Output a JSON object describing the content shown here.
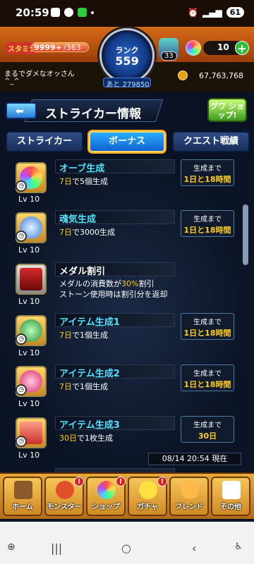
{
  "status": {
    "time": "20:59",
    "battery": "61"
  },
  "header": {
    "stamina_label": "スタミナ",
    "stamina_current": "9999+",
    "stamina_max": "/363",
    "rank_label": "ランク",
    "rank_value": "559",
    "exp_text": "あと 279850",
    "player_name": "まるでダメなオッさん",
    "player_sub": "^_^",
    "gem_count": "33",
    "orb_count": "10",
    "coins": "67,763,768"
  },
  "title": {
    "text": "ストライカー情報",
    "gwa_label": "グワ ショップ!"
  },
  "tabs": [
    {
      "label": "ストライカー"
    },
    {
      "label": "ボーナス"
    },
    {
      "label": "クエスト戦績"
    }
  ],
  "skills": [
    {
      "title": "オーブ生成",
      "desc_yellow": "7日",
      "desc_rest": "で5個生成",
      "level": "Lv 10",
      "gen_label": "生成まで",
      "gen_value": "1日と18時間",
      "color": "#54e0ff"
    },
    {
      "title": "魂気生成",
      "desc_yellow": "7日",
      "desc_rest": "で3000生成",
      "level": "Lv 10",
      "gen_label": "生成まで",
      "gen_value": "1日と18時間",
      "color": "#54e0ff"
    },
    {
      "title": "メダル割引",
      "desc_line1_a": "メダルの消費数が",
      "desc_line1_b": "30%",
      "desc_line1_c": "割引",
      "desc_line2": "ストーン使用時は割引分を返却",
      "level": "Lv 10",
      "color": "#ffffff"
    },
    {
      "title": "アイテム生成1",
      "desc_yellow": "7日",
      "desc_rest": "で1個生成",
      "level": "Lv 10",
      "gen_label": "生成まで",
      "gen_value": "1日と18時間",
      "color": "#54e0ff"
    },
    {
      "title": "アイテム生成2",
      "desc_yellow": "7日",
      "desc_rest": "で1個生成",
      "level": "Lv 10",
      "gen_label": "生成まで",
      "gen_value": "1日と18時間",
      "color": "#54e0ff"
    },
    {
      "title": "アイテム生成3",
      "desc_yellow": "30日",
      "desc_rest": "で1枚生成",
      "level": "Lv 10",
      "gen_label": "生成まで",
      "gen_value": "30日",
      "color": "#54e0ff"
    }
  ],
  "timestamp": "08/14 20:54 現在",
  "nav": [
    {
      "label": "ホーム"
    },
    {
      "label": "モンスター",
      "badge": "!"
    },
    {
      "label": "ショップ",
      "badge": "!"
    },
    {
      "label": "ガチャ",
      "badge": "!"
    },
    {
      "label": "フレンド"
    },
    {
      "label": "その他"
    }
  ]
}
